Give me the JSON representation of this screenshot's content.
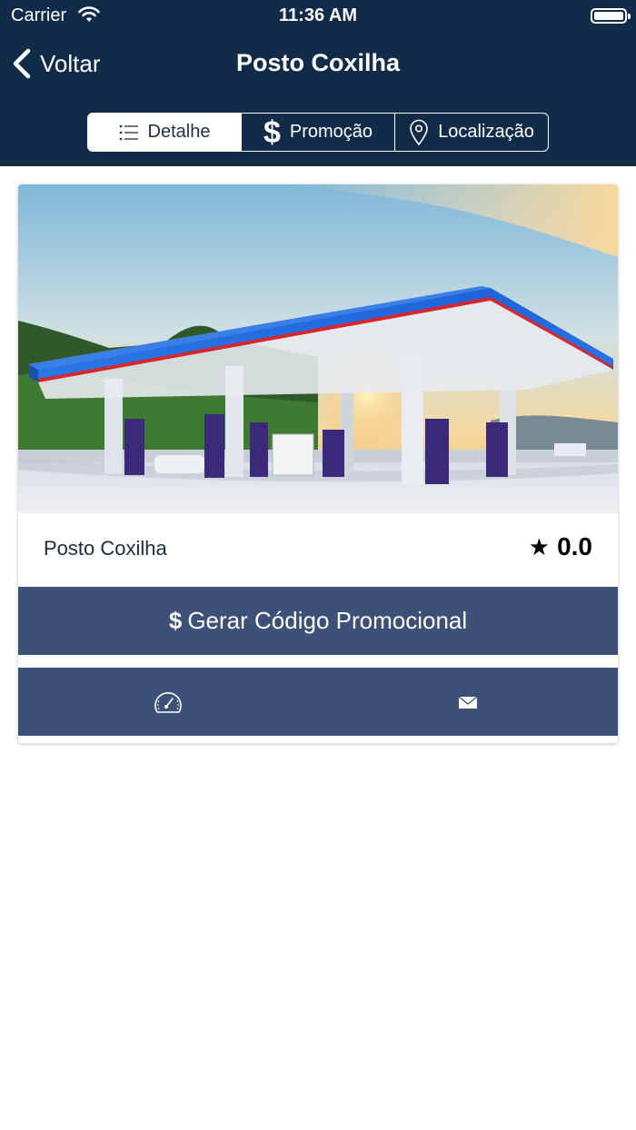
{
  "status_bar": {
    "carrier": "Carrier",
    "time": "11:36 AM"
  },
  "nav": {
    "back_label": "Voltar",
    "title": "Posto Coxilha"
  },
  "segments": [
    {
      "label": "Detalhe",
      "icon": "list-icon",
      "selected": true
    },
    {
      "label": "Promoção",
      "icon": "dollar-icon",
      "selected": false
    },
    {
      "label": "Localização",
      "icon": "location-pin-icon",
      "selected": false
    }
  ],
  "station": {
    "name": "Posto Coxilha",
    "rating": "0.0",
    "photo": "gas-station-photo"
  },
  "promo_button": {
    "symbol": "$",
    "label": "Gerar Código Promocional"
  },
  "actions": [
    {
      "icon": "speedometer-icon"
    },
    {
      "icon": "mail-icon"
    }
  ],
  "colors": {
    "header_bg": "#122b49",
    "button_bg": "#3d5078",
    "text_dark": "#1c2a40"
  }
}
